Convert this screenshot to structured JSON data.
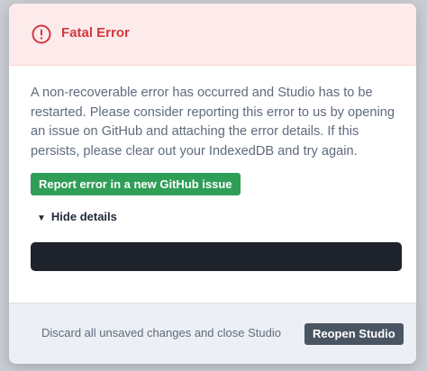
{
  "colors": {
    "error_red": "#d3383e",
    "header_bg": "#fdebeb",
    "success_green": "#2f9e57",
    "details_dark": "#1e222b",
    "footer_bg": "#eceff4",
    "secondary_button": "#4a5563"
  },
  "header": {
    "icon": "alert-circle-icon",
    "title": "Fatal Error"
  },
  "body": {
    "message": "A non-recoverable error has occurred and Studio has to be restarted. Please consider reporting this error to us by opening an issue on GitHub and attaching the error details. If this persists, please clear out your IndexedDB and try again.",
    "report_button_label": "Report error in a new GitHub issue",
    "details_caret": "▼",
    "details_toggle_label": "Hide details"
  },
  "footer": {
    "discard_label": "Discard all unsaved changes and close Studio",
    "reopen_button_label": "Reopen Studio"
  }
}
